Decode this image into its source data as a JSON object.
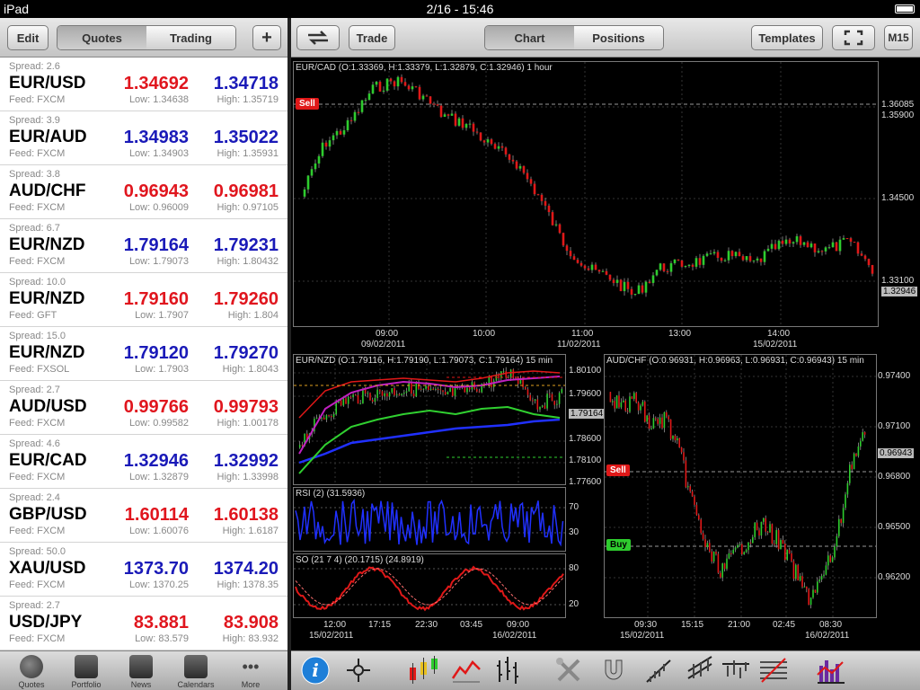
{
  "status": {
    "device": "iPad",
    "time": "2/16 - 15:46"
  },
  "left_toolbar": {
    "edit": "Edit",
    "tab_quotes": "Quotes",
    "tab_trading": "Trading",
    "add": "+"
  },
  "right_toolbar": {
    "trade": "Trade",
    "tab_chart": "Chart",
    "tab_positions": "Positions",
    "templates": "Templates",
    "timeframe": "M15"
  },
  "quotes": [
    {
      "spread": "Spread: 2.6",
      "symbol": "EUR/USD",
      "bid": "1.34692",
      "ask": "1.34718",
      "feed": "Feed: FXCM",
      "low": "Low: 1.34638",
      "high": "High: 1.35719",
      "bid_color": "red",
      "ask_color": "blue"
    },
    {
      "spread": "Spread: 3.9",
      "symbol": "EUR/AUD",
      "bid": "1.34983",
      "ask": "1.35022",
      "feed": "Feed: FXCM",
      "low": "Low: 1.34903",
      "high": "High: 1.35931",
      "bid_color": "blue",
      "ask_color": "blue"
    },
    {
      "spread": "Spread: 3.8",
      "symbol": "AUD/CHF",
      "bid": "0.96943",
      "ask": "0.96981",
      "feed": "Feed: FXCM",
      "low": "Low: 0.96009",
      "high": "High: 0.97105",
      "bid_color": "red",
      "ask_color": "red"
    },
    {
      "spread": "Spread: 6.7",
      "symbol": "EUR/NZD",
      "bid": "1.79164",
      "ask": "1.79231",
      "feed": "Feed: FXCM",
      "low": "Low: 1.79073",
      "high": "High: 1.80432",
      "bid_color": "blue",
      "ask_color": "blue"
    },
    {
      "spread": "Spread: 10.0",
      "symbol": "EUR/NZD",
      "bid": "1.79160",
      "ask": "1.79260",
      "feed": "Feed: GFT",
      "low": "Low: 1.7907",
      "high": "High: 1.804",
      "bid_color": "red",
      "ask_color": "red"
    },
    {
      "spread": "Spread: 15.0",
      "symbol": "EUR/NZD",
      "bid": "1.79120",
      "ask": "1.79270",
      "feed": "Feed: FXSOL",
      "low": "Low: 1.7903",
      "high": "High: 1.8043",
      "bid_color": "blue",
      "ask_color": "blue"
    },
    {
      "spread": "Spread: 2.7",
      "symbol": "AUD/USD",
      "bid": "0.99766",
      "ask": "0.99793",
      "feed": "Feed: FXCM",
      "low": "Low: 0.99582",
      "high": "High: 1.00178",
      "bid_color": "red",
      "ask_color": "red"
    },
    {
      "spread": "Spread: 4.6",
      "symbol": "EUR/CAD",
      "bid": "1.32946",
      "ask": "1.32992",
      "feed": "Feed: FXCM",
      "low": "Low: 1.32879",
      "high": "High: 1.33998",
      "bid_color": "blue",
      "ask_color": "blue"
    },
    {
      "spread": "Spread: 2.4",
      "symbol": "GBP/USD",
      "bid": "1.60114",
      "ask": "1.60138",
      "feed": "Feed: FXCM",
      "low": "Low: 1.60076",
      "high": "High: 1.6187",
      "bid_color": "red",
      "ask_color": "red"
    },
    {
      "spread": "Spread: 50.0",
      "symbol": "XAU/USD",
      "bid": "1373.70",
      "ask": "1374.20",
      "feed": "Feed: FXCM",
      "low": "Low: 1370.25",
      "high": "High: 1378.35",
      "bid_color": "blue",
      "ask_color": "blue"
    },
    {
      "spread": "Spread: 2.7",
      "symbol": "USD/JPY",
      "bid": "83.881",
      "ask": "83.908",
      "feed": "Feed: FXCM",
      "low": "Low: 83.579",
      "high": "High: 83.932",
      "bid_color": "red",
      "ask_color": "red"
    }
  ],
  "bottom_tabs": [
    "Quotes",
    "Portfolio",
    "News",
    "Calendars",
    "More"
  ],
  "chart_main": {
    "title": "EUR/CAD (O:1.33369, H:1.33379, L:1.32879, C:1.32946) 1 hour",
    "sell": "Sell",
    "y_ticks": [
      "1.36085",
      "1.35900",
      "1.34500",
      "1.33100"
    ],
    "price_tag": "1.32946",
    "x_ticks": [
      "09:00",
      "10:00",
      "11:00",
      "13:00",
      "14:00"
    ],
    "x_dates": [
      "09/02/2011",
      "11/02/2011",
      "15/02/2011"
    ]
  },
  "chart_nzd": {
    "title": "EUR/NZD (O:1.79116, H:1.79190, L:1.79073, C:1.79164) 15 min",
    "y_ticks": [
      "1.80100",
      "1.79600",
      "1.78600",
      "1.78100",
      "1.77600"
    ],
    "price_tag": "1.79164"
  },
  "chart_rsi": {
    "title": "RSI (2) (31.5936)",
    "y_ticks": [
      "70",
      "30"
    ]
  },
  "chart_so": {
    "title": "SO (21 7 4) (20.1715) (24.8919)",
    "y_ticks": [
      "80",
      "20"
    ],
    "x_ticks": [
      "12:00",
      "17:15",
      "22:30",
      "03:45",
      "09:00"
    ],
    "x_dates": [
      "15/02/2011",
      "16/02/2011"
    ]
  },
  "chart_aud": {
    "title": "AUD/CHF (O:0.96931, H:0.96963, L:0.96931, C:0.96943) 15 min",
    "sell": "Sell",
    "buy": "Buy",
    "y_ticks": [
      "0.97400",
      "0.97100",
      "0.96800",
      "0.96500",
      "0.96200"
    ],
    "price_tag": "0.96943",
    "x_ticks": [
      "09:30",
      "15:15",
      "21:00",
      "02:45",
      "08:30"
    ],
    "x_dates": [
      "15/02/2011",
      "16/02/2011"
    ]
  },
  "colors": {
    "bid_red": "#e0161e",
    "ask_blue": "#1a1ab8",
    "candle_up": "#2ecc2e",
    "candle_down": "#e01818"
  }
}
